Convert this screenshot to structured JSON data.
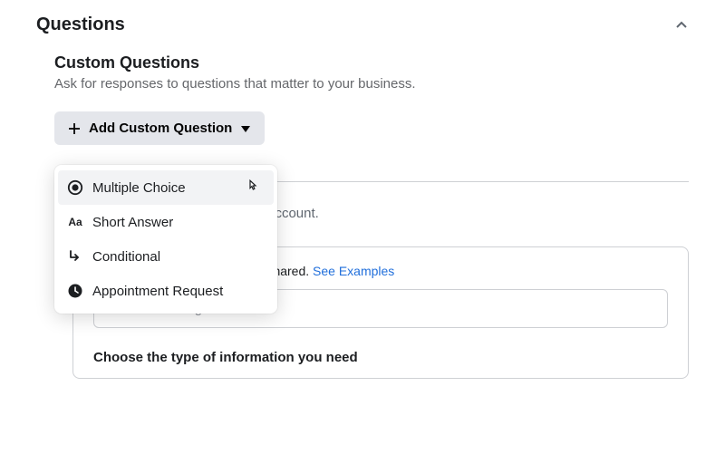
{
  "section": {
    "title": "Questions"
  },
  "custom": {
    "title": "Custom Questions",
    "desc": "Ask for responses to questions that matter to your business.",
    "add_button": "Add Custom Question"
  },
  "dropdown": {
    "items": [
      {
        "label": "Multiple Choice"
      },
      {
        "label": "Short Answer"
      },
      {
        "label": "Conditional"
      },
      {
        "label": "Appointment Request"
      }
    ]
  },
  "prefill": {
    "fragment": "be prefilled from their Facebook account."
  },
  "card": {
    "intro_fragment": "n they give you will be used or shared. ",
    "see_examples": "See Examples",
    "message_placeholder": "Enter a message",
    "choose_label": "Choose the type of information you need"
  }
}
